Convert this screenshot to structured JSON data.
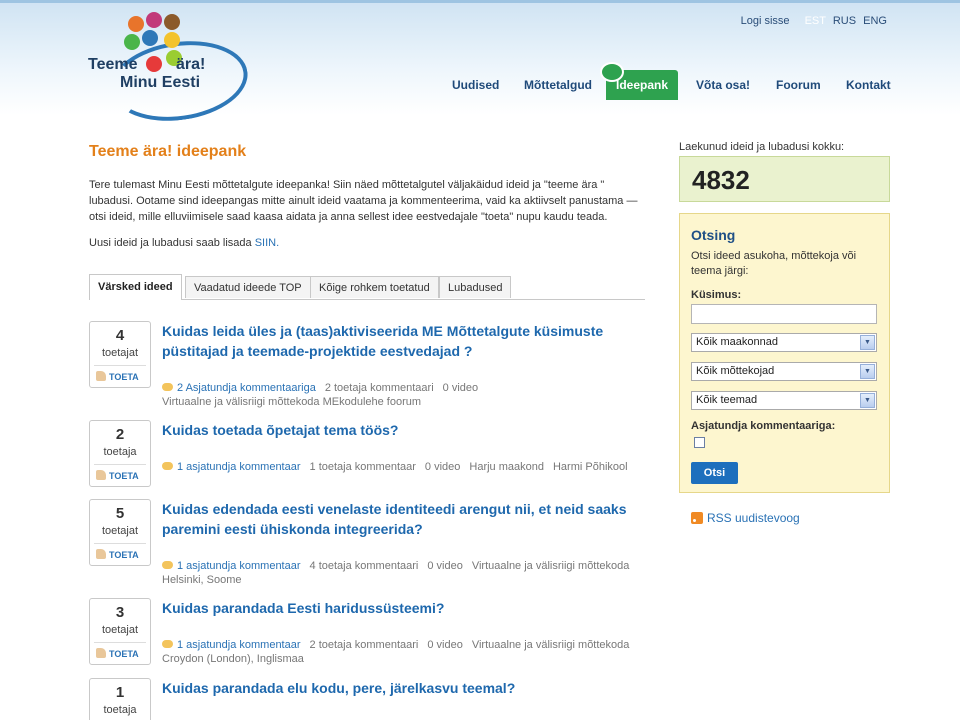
{
  "logo": {
    "line1": "Teeme",
    "line2": "ära!",
    "line3": "Minu Eesti"
  },
  "header": {
    "login": "Logi sisse",
    "langs": [
      {
        "label": "EST",
        "active": true
      },
      {
        "label": "RUS",
        "active": false
      },
      {
        "label": "ENG",
        "active": false
      }
    ]
  },
  "nav": {
    "items": [
      "Uudised",
      "Mõttetalgud",
      "Ideepank",
      "Võta osa!",
      "Foorum",
      "Kontakt"
    ],
    "active": "Ideepank"
  },
  "main": {
    "title": "Teeme ära! ideepank",
    "intro": "Tere tulemast Minu Eesti mõttetalgute ideepanka! Siin näed mõttetalgutel väljakäidud ideid ja \"teeme ära \" lubadusi. Ootame sind ideepangas mitte ainult ideid vaatama ja kommenteerima, vaid ka aktiivselt panustama — otsi ideid, mille elluviimisele saad kaasa aidata ja anna sellest idee eestvedajale \"toeta\" nupu kaudu teada.",
    "add_text": "Uusi ideid ja lubadusi saab lisada ",
    "add_link": "SIIN.",
    "tabs": [
      "Värsked ideed",
      "Vaadatud ideede TOP",
      "Kõige rohkem toetatud",
      "Lubadused"
    ],
    "vote_button": "TOETA",
    "ideas": [
      {
        "count": "4",
        "count_label": "toetajat",
        "title": "Kuidas leida üles ja (taas)aktiviseerida ME Mõttetalgute küsimuste püstitajad ja teemade-projektide eestvedajad ?",
        "expert": "2 Asjatundja kommentaariga",
        "comments": "2 toetaja kommentaari",
        "video": "0 video",
        "meta2": "Virtuaalne ja välisriigi mõttekoda   MEkodulehe foorum"
      },
      {
        "count": "2",
        "count_label": "toetaja",
        "title": "Kuidas toetada õpetajat tema töös?",
        "expert": "1 asjatundja kommentaar",
        "comments": "1 toetaja kommentaar",
        "video": "0 video",
        "location": "Harju maakond",
        "place": "Harmi Põhikool"
      },
      {
        "count": "5",
        "count_label": "toetajat",
        "title": "Kuidas edendada eesti venelaste identiteedi arengut nii, et neid saaks paremini eesti ühiskonda integreerida?",
        "expert": "1 asjatundja kommentaar",
        "comments": "4 toetaja kommentaari",
        "video": "0 video",
        "location": "Virtuaalne ja välisriigi mõttekoda",
        "meta2": "Helsinki, Soome"
      },
      {
        "count": "3",
        "count_label": "toetajat",
        "title": "Kuidas parandada Eesti haridussüsteemi?",
        "expert": "1 asjatundja kommentaar",
        "comments": "2 toetaja kommentaari",
        "video": "0 video",
        "location": "Virtuaalne ja välisriigi mõttekoda",
        "meta2": "Croydon (London), Inglismaa"
      },
      {
        "count": "1",
        "count_label": "toetaja",
        "title": "Kuidas parandada elu kodu, pere, järelkasvu teemal?"
      }
    ]
  },
  "sidebar": {
    "count_label": "Laekunud ideid ja lubadusi kokku:",
    "count_value": "4832",
    "search": {
      "title": "Otsing",
      "desc": "Otsi ideed asukoha, mõttekoja või teema järgi:",
      "q_label": "Küsimus:",
      "q_value": "",
      "select_county": "Kõik maakonnad",
      "select_thinktank": "Kõik mõttekojad",
      "select_topic": "Kõik teemad",
      "expert_label": "Asjatundja kommentaariga:",
      "button": "Otsi"
    },
    "rss": "RSS uudistevoog"
  },
  "colors": {
    "accent": "#e3801a",
    "link": "#1e68ad",
    "nav_active": "#2ea24f",
    "button": "#1d6fbd"
  }
}
